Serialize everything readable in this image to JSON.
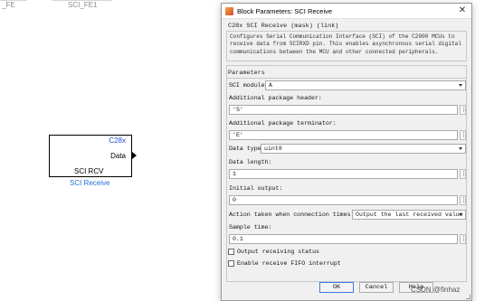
{
  "canvas": {
    "left_block_label": "_FE",
    "right_block_label": "SCI_FE1",
    "block": {
      "tag": "C28x",
      "port": "Data",
      "name": "SCI RCV",
      "caption": "SCI Receive"
    }
  },
  "dialog": {
    "title": "Block Parameters: SCI Receive",
    "close_glyph": "✕",
    "description_title": "C28x SCI Receive (mask) (link)",
    "description": "Configures Serial Communication Interface (SCI) of the C2000 MCUs to receive data from SCIRXD pin. This enables asynchronous serial digital communications between the MCU and other connected peripherals.",
    "section_title": "Parameters",
    "sci_module": {
      "label": "SCI module:",
      "value": "A"
    },
    "package_header": {
      "label": "Additional package header:",
      "value": "'S'"
    },
    "package_terminator": {
      "label": "Additional package terminator:",
      "value": "'E'"
    },
    "data_type": {
      "label": "Data type:",
      "value": "uint8"
    },
    "data_length": {
      "label": "Data length:",
      "value": "1"
    },
    "initial_output": {
      "label": "Initial output:",
      "value": "0"
    },
    "timeout_action": {
      "label": "Action taken when connection times out:",
      "value": "Output the last received value"
    },
    "sample_time": {
      "label": "Sample time:",
      "value": "0.1"
    },
    "output_status": {
      "label": "Output receiving status",
      "checked": false
    },
    "fifo_interrupt": {
      "label": "Enable receive FIFO interrupt",
      "checked": false
    },
    "kebab_glyph": "⋮",
    "buttons": {
      "ok": "OK",
      "cancel": "Cancel",
      "help": "Help"
    }
  },
  "watermark": "CSDN @finhaz",
  "colors": {
    "block_tag": "#1f4fd0",
    "block_caption": "#1f6fd9",
    "ok_border": "#3b7be0"
  }
}
